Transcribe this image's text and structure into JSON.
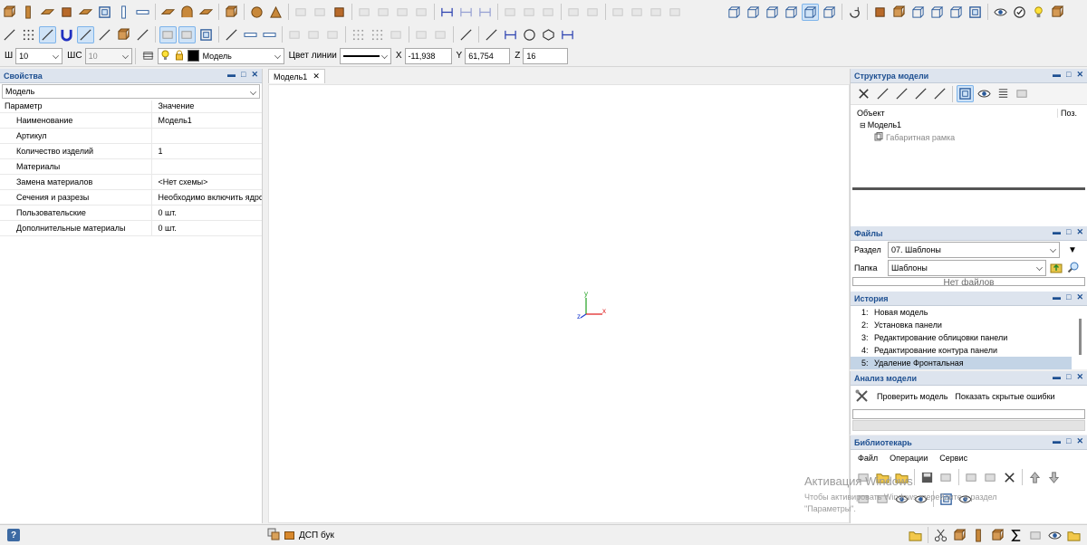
{
  "toolbars": {
    "grid_label": "Ш",
    "grid_value": "10",
    "snap_label": "ШС",
    "snap_value": "10",
    "layer_value": "Модель",
    "line_color_label": "Цвет линии",
    "x_label": "X",
    "x_value": "-11,938",
    "y_label": "Y",
    "y_value": "61,754",
    "z_label": "Z",
    "z_value": "16"
  },
  "properties": {
    "title": "Свойства",
    "object_type": "Модель",
    "header_key": "Параметр",
    "header_value": "Значение",
    "rows": [
      {
        "key": "Наименование",
        "value": "Модель1"
      },
      {
        "key": "Артикул",
        "value": ""
      },
      {
        "key": "Количество изделий",
        "value": "1"
      },
      {
        "key": "Материалы",
        "value": ""
      },
      {
        "key": "Замена материалов",
        "value": "<Нет схемы>"
      },
      {
        "key": "Сечения и разрезы",
        "value": "Необходимо включить ядро"
      },
      {
        "key": "Пользовательские",
        "value": "0 шт."
      },
      {
        "key": "Дополнительные материалы",
        "value": "0 шт."
      }
    ]
  },
  "document": {
    "tab_label": "Модель1",
    "axis_x": "x",
    "axis_y": "y",
    "axis_z": "z"
  },
  "model_tree": {
    "title": "Структура модели",
    "col_object": "Объект",
    "col_pos": "Поз.",
    "root": "Модель1",
    "child": "Габаритная рамка"
  },
  "files": {
    "title": "Файлы",
    "section_label": "Раздел",
    "section_value": "07. Шаблоны",
    "folder_label": "Папка",
    "folder_value": "Шаблоны",
    "empty_text": "Нет файлов"
  },
  "history": {
    "title": "История",
    "items": [
      {
        "n": "1:",
        "text": "Новая модель"
      },
      {
        "n": "2:",
        "text": "Установка панели"
      },
      {
        "n": "3:",
        "text": "Редактирование облицовки панели"
      },
      {
        "n": "4:",
        "text": "Редактирование контура панели"
      },
      {
        "n": "5:",
        "text": "Удаление Фронтальная"
      }
    ]
  },
  "analysis": {
    "title": "Анализ модели",
    "check_label": "Проверить модель",
    "errors_label": "Показать скрытые ошибки"
  },
  "library": {
    "title": "Библиотекарь",
    "menu": [
      "Файл",
      "Операции",
      "Сервис"
    ]
  },
  "watermark": {
    "line1": "Активация Windows",
    "line2": "Чтобы активировать Windows, перейдите в раздел",
    "line3": "\"Параметры\"."
  },
  "status": {
    "help": "?",
    "material": "ДСП бук"
  },
  "colors": {
    "panel_title": "#1d4f91",
    "selected_row": "#c3d4e6",
    "axis_x": "#e02020",
    "axis_y": "#20a020",
    "axis_z": "#2040d0"
  }
}
